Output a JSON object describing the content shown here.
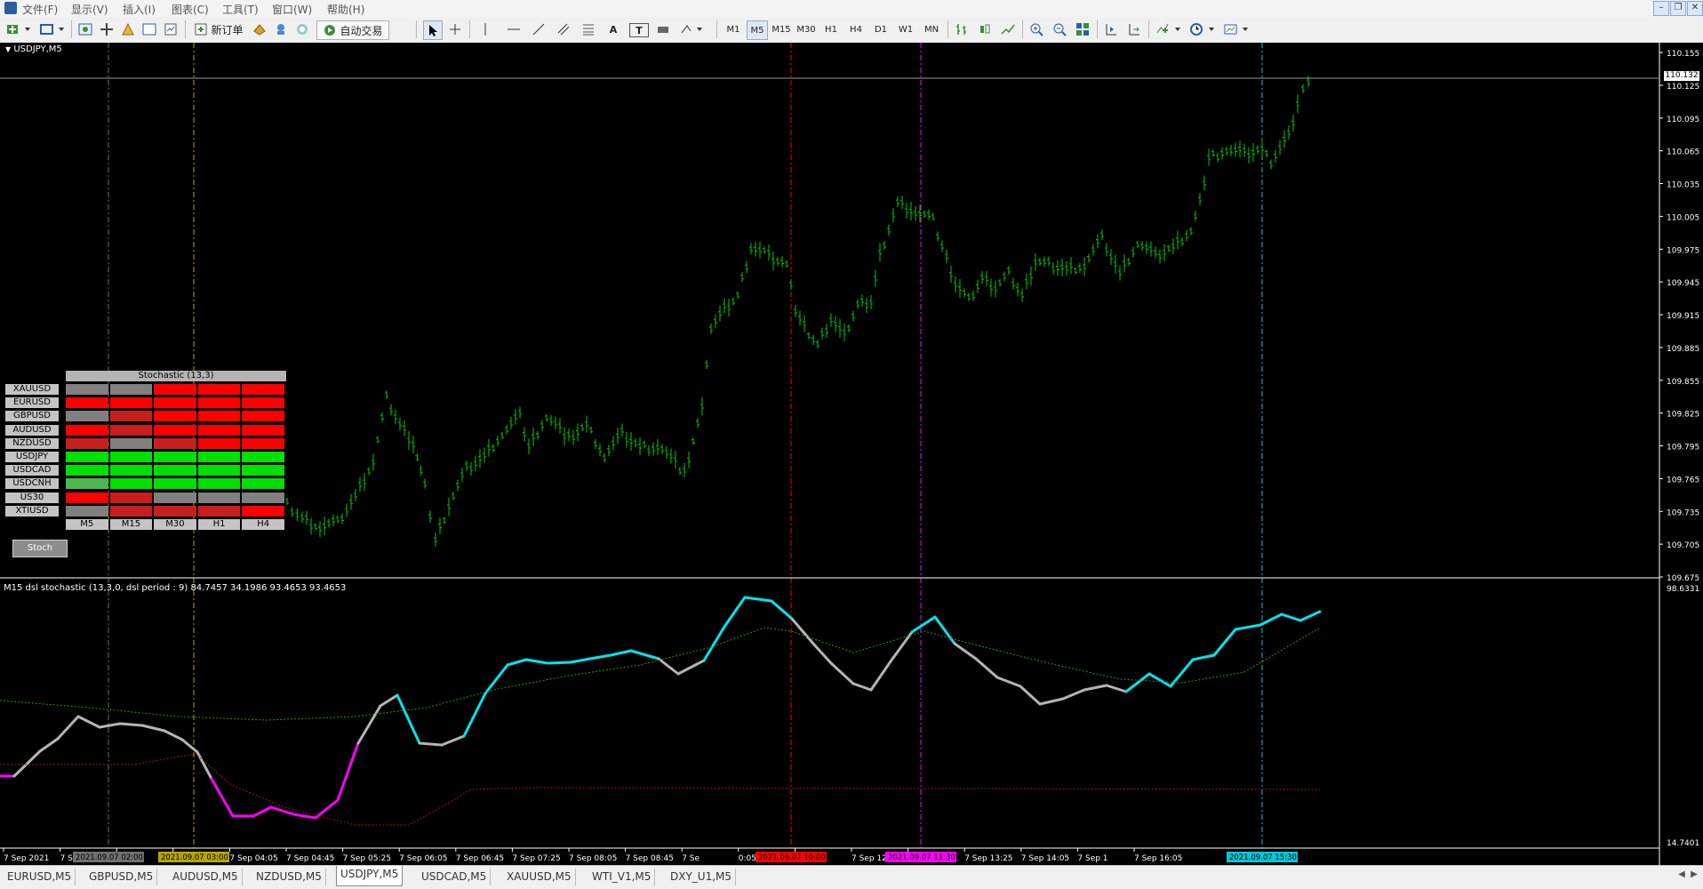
{
  "menu": [
    "文件(F)",
    "显示(V)",
    "插入(I)",
    "图表(C)",
    "工具(T)",
    "窗口(W)",
    "帮助(H)"
  ],
  "toolbar": {
    "new_order": "新订单",
    "auto_trade": "自动交易",
    "text_tool": "A",
    "text_label_tool": "T",
    "timeframes": [
      "M1",
      "M5",
      "M15",
      "M30",
      "H1",
      "H4",
      "D1",
      "W1",
      "MN"
    ],
    "active_timeframe": "M5"
  },
  "chart": {
    "symbol_title": "USDJPY,M5",
    "price_axis": [
      "110.155",
      "110.125",
      "110.095",
      "110.065",
      "110.035",
      "110.005",
      "109.975",
      "109.945",
      "109.915",
      "109.885",
      "109.855",
      "109.825",
      "109.795",
      "109.765",
      "109.735",
      "109.705",
      "109.675"
    ],
    "current_price": "110.132",
    "indicator_title": "M15 dsl stochastic (13,3,0, dsl period : 9) 84.7457 34.1986 93.4653 93.4653",
    "indicator_axis_top": "98.6331",
    "indicator_axis_bottom": "14.7401",
    "time_axis": [
      "7 Sep 2021",
      "7 Sep 02:45",
      "2:05",
      "7 Sep 03:25",
      "7 Sep 04:05",
      "7 Sep 04:45",
      "7 Sep 05:25",
      "7 Sep 06:05",
      "7 Sep 06:45",
      "7 Sep 07:25",
      "7 Sep 08:05",
      "7 Sep 08:45",
      "7 Se",
      "0:05",
      "7 Sep 1",
      "7 Sep 12:05",
      "7 Sep 12:45",
      "7 Sep 13:25",
      "7 Sep 14:05",
      "7 Sep 1",
      "7 Sep 16:05"
    ],
    "time_markers": [
      {
        "label": "2021.09.07 02:00",
        "color": "#707070"
      },
      {
        "label": "2021.09.07 03:00",
        "color": "#b5a600"
      },
      {
        "label": "2021.09.07 10:00",
        "color": "#ff0000"
      },
      {
        "label": "2021.09.07 11:30",
        "color": "#ff00ff"
      },
      {
        "label": "2021.09.07 15:30",
        "color": "#00c8d8"
      }
    ]
  },
  "stoch_table": {
    "title": "Stochastic (13,3)",
    "rows": [
      "XAUUSD",
      "EURUSD",
      "GBPUSD",
      "AUDUSD",
      "NZDUSD",
      "USDJPY",
      "USDCAD",
      "USDCNH",
      "US30",
      "XTIUSD"
    ],
    "columns": [
      "M5",
      "M15",
      "M30",
      "H1",
      "H4"
    ],
    "cells": [
      [
        "gray",
        "gray",
        "red",
        "red",
        "red"
      ],
      [
        "red",
        "red",
        "red",
        "red",
        "red"
      ],
      [
        "gray",
        "dkred",
        "red",
        "red",
        "red"
      ],
      [
        "red",
        "dkred",
        "red",
        "red",
        "red"
      ],
      [
        "dkred",
        "gray",
        "dkred",
        "red",
        "red"
      ],
      [
        "green",
        "green",
        "green",
        "green",
        "green"
      ],
      [
        "green",
        "green",
        "green",
        "green",
        "green"
      ],
      [
        "dkgreen",
        "green",
        "green",
        "green",
        "green"
      ],
      [
        "red",
        "dkred",
        "gray",
        "gray",
        "gray"
      ],
      [
        "gray",
        "dkred",
        "dkred",
        "dkred",
        "red"
      ]
    ],
    "button": "Stoch"
  },
  "colors": {
    "candle": "#00c800",
    "red": "#ff0000",
    "dkred": "#c81e1e",
    "gray": "#808080",
    "green": "#00e000",
    "dkgreen": "#4db84d",
    "stoch_up": "#00e5ee",
    "stoch_neutral": "#b4b4b4",
    "stoch_down": "#ff00ff"
  },
  "tabs": [
    "EURUSD,M5",
    "GBPUSD,M5",
    "AUDUSD,M5",
    "NZDUSD,M5",
    "USDJPY,M5",
    "USDCAD,M5",
    "XAUUSD,M5",
    "WTI_V1,M5",
    "DXY_U1,M5"
  ],
  "active_tab": "USDJPY,M5"
}
